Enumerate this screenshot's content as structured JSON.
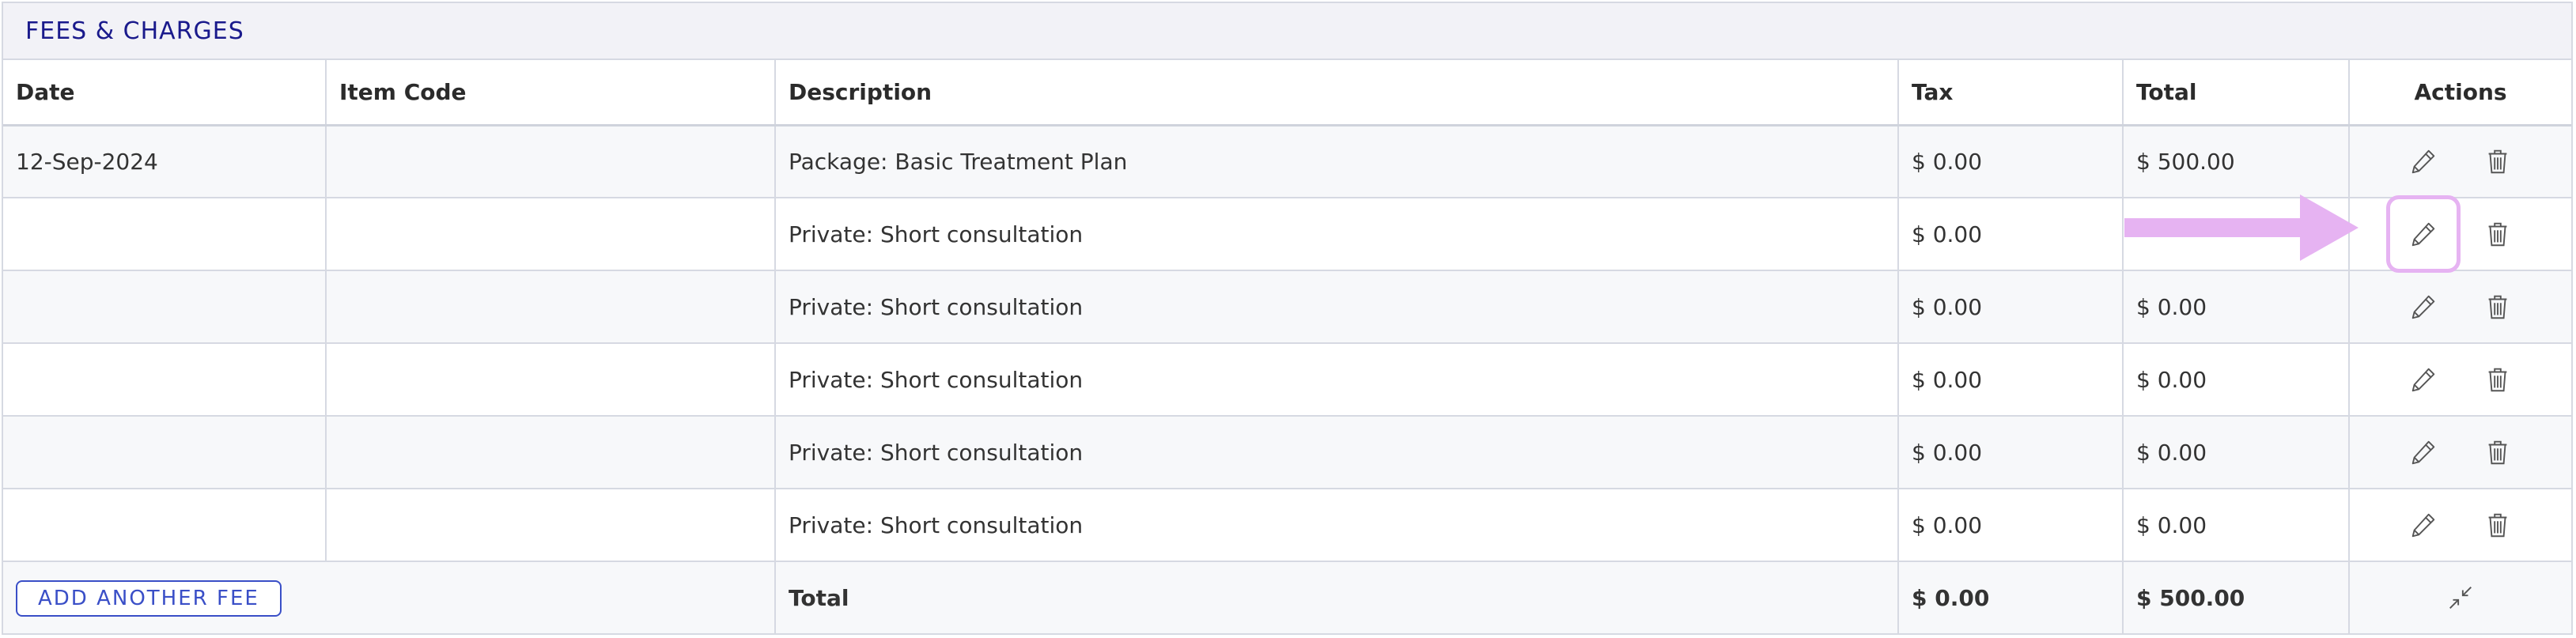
{
  "panel": {
    "title": "FEES & CHARGES"
  },
  "table": {
    "columns": {
      "date": "Date",
      "item_code": "Item Code",
      "description": "Description",
      "tax": "Tax",
      "total": "Total",
      "actions": "Actions"
    },
    "rows": [
      {
        "date": "12-Sep-2024",
        "item_code": "",
        "description": "Package: Basic Treatment Plan",
        "tax": "$ 0.00",
        "total": "$ 500.00"
      },
      {
        "date": "",
        "item_code": "",
        "description": "Private: Short consultation",
        "tax": "$ 0.00",
        "total": ""
      },
      {
        "date": "",
        "item_code": "",
        "description": "Private: Short consultation",
        "tax": "$ 0.00",
        "total": "$ 0.00"
      },
      {
        "date": "",
        "item_code": "",
        "description": "Private: Short consultation",
        "tax": "$ 0.00",
        "total": "$ 0.00"
      },
      {
        "date": "",
        "item_code": "",
        "description": "Private: Short consultation",
        "tax": "$ 0.00",
        "total": "$ 0.00"
      },
      {
        "date": "",
        "item_code": "",
        "description": "Private: Short consultation",
        "tax": "$ 0.00",
        "total": "$ 0.00"
      }
    ],
    "footer": {
      "add_button_label": "ADD ANOTHER FEE",
      "total_label": "Total",
      "tax_total": "$ 0.00",
      "grand_total": "$ 500.00"
    }
  },
  "icons": {
    "edit": "pencil-icon",
    "delete": "trash-icon",
    "collapse": "collapse-icon"
  },
  "colors": {
    "title": "#1a1a8c",
    "accent": "#3a4fc7",
    "highlight": "#e6b3f2",
    "border": "#d6d9e2",
    "header_bg": "#f2f2f7"
  }
}
